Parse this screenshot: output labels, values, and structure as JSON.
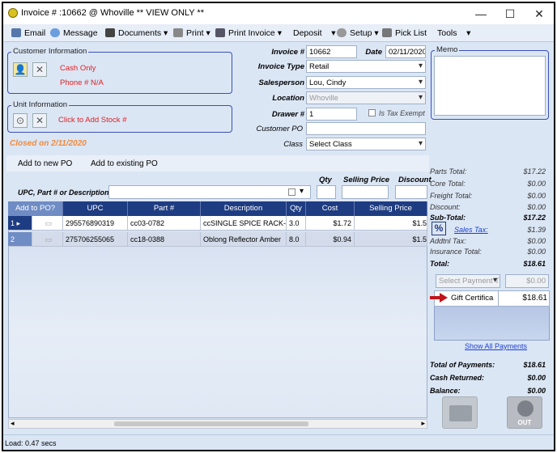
{
  "window": {
    "title": "Invoice # :10662 @ Whoville ** VIEW ONLY **",
    "minimize": "—",
    "maximize": "☐",
    "close": "✕"
  },
  "toolbar": {
    "email": "Email",
    "message": "Message",
    "documents": "Documents",
    "print": "Print",
    "print_invoice": "Print Invoice",
    "deposit": "Deposit",
    "setup": "Setup",
    "pick_list": "Pick List",
    "tools": "Tools"
  },
  "customer": {
    "legend": "Customer Information",
    "cash_only": "Cash Only",
    "phone": "Phone # N/A"
  },
  "unit": {
    "legend": "Unit Information",
    "add_stock": "Click to Add Stock #"
  },
  "closed_on": "Closed on 2/11/2020",
  "form": {
    "invoice_label": "Invoice #",
    "invoice_value": "10662",
    "date_label": "Date",
    "date_value": "02/11/2020",
    "type_label": "Invoice Type",
    "type_value": "Retail",
    "salesperson_label": "Salesperson",
    "salesperson_value": "Lou, Cindy",
    "location_label": "Location",
    "location_value": "Whoville",
    "drawer_label": "Drawer #",
    "drawer_value": "1",
    "tax_exempt_label": "Is Tax Exempt",
    "customer_po_label": "Customer PO",
    "class_label": "Class",
    "class_value": "Select Class"
  },
  "memo": {
    "legend": "Memo"
  },
  "po": {
    "new": "Add to new PO",
    "existing": "Add to existing PO"
  },
  "entry": {
    "upc_label": "UPC, Part # or Description",
    "qty_label": "Qty",
    "price_label": "Selling Price",
    "discount_label": "Discount"
  },
  "grid": {
    "headers": [
      "Add to PO?",
      "UPC",
      "Part #",
      "Description",
      "Qty",
      "Cost",
      "Selling Price"
    ],
    "rows": [
      {
        "num": "1",
        "upc": "295576890319",
        "part": "cc03-0782",
        "desc": "ccSINGLE SPICE RACK-W",
        "qty": "3.0",
        "cost": "$1.72",
        "price": "$1.5"
      },
      {
        "num": "2",
        "upc": "275706255065",
        "part": "cc18-0388",
        "desc": "Oblong Reflector Amber",
        "qty": "8.0",
        "cost": "$0.94",
        "price": "$1.5"
      }
    ]
  },
  "totals": {
    "parts_total_label": "Parts Total:",
    "parts_total": "$17.22",
    "core_total_label": "Core Total:",
    "core_total": "$0.00",
    "freight_total_label": "Freight Total:",
    "freight_total": "$0.00",
    "discount_label": "Discount:",
    "discount": "$0.00",
    "subtotal_label": "Sub-Total:",
    "subtotal": "$17.22",
    "sales_tax_label": "Sales Tax:",
    "sales_tax": "$1.39",
    "addtl_tax_label": "Addtnl Tax:",
    "addtl_tax": "$0.00",
    "insurance_label": "Insurance Total:",
    "insurance": "$0.00",
    "total_label": "Total:",
    "total": "$18.61"
  },
  "payment": {
    "select_placeholder": "Select Payment T",
    "amount_value": "$0.00",
    "method": "Gift Certifica",
    "method_amount": "$18.61",
    "show_all": "Show All Payments",
    "total_payments_label": "Total of Payments:",
    "total_payments": "$18.61",
    "cash_returned_label": "Cash Returned:",
    "cash_returned": "$0.00",
    "balance_label": "Balance:",
    "balance": "$0.00",
    "out_label": "OUT"
  },
  "status": {
    "text": "Load: 0.47 secs"
  },
  "colors": {
    "accent_blue": "#1e3c82",
    "closed_orange": "#f08a3c",
    "red_text": "#e02020",
    "link_blue": "#1b3fd1"
  }
}
